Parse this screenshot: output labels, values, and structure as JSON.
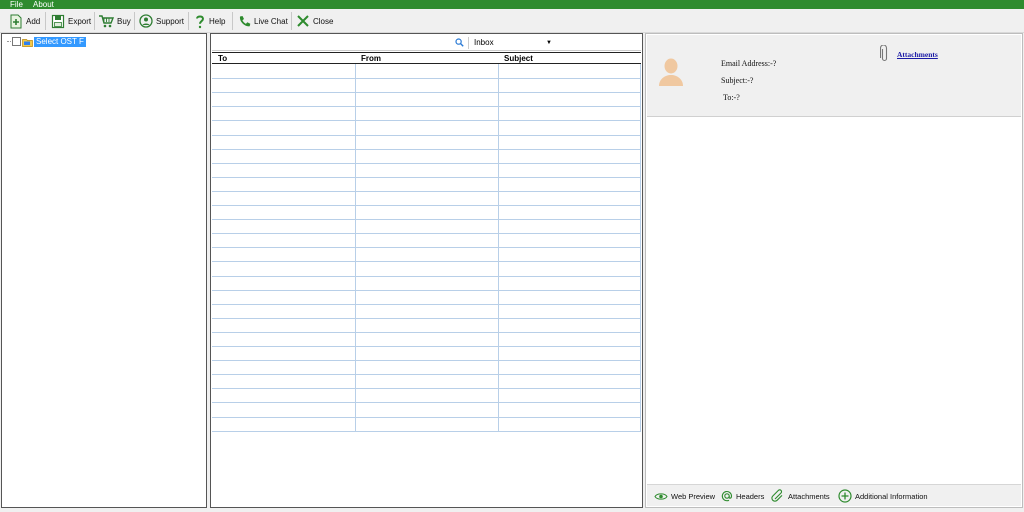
{
  "menu": {
    "file": "File",
    "about": "About"
  },
  "toolbar": {
    "add": "Add",
    "export": "Export",
    "buy": "Buy",
    "support": "Support",
    "help": "Help",
    "live_chat": "Live Chat",
    "close": "Close"
  },
  "tree": {
    "root_label": "Select OST F"
  },
  "search": {
    "placeholder": "",
    "folder": "Inbox"
  },
  "mail_list": {
    "columns": [
      "To",
      "From",
      "Subject"
    ],
    "rows": []
  },
  "preview": {
    "email_address": "Email Address:-?",
    "subject": "Subject:-?",
    "to": "To:-?",
    "attachments_link": "Attachments"
  },
  "bottom_tabs": {
    "web_preview": "Web Preview",
    "headers": "Headers",
    "attachments": "Attachments",
    "additional_info": "Additional Information"
  },
  "colors": {
    "accent": "#2e8b2e",
    "selection": "#3399ff",
    "link": "#1a1aa6",
    "grid_line": "#b8cfe8"
  }
}
